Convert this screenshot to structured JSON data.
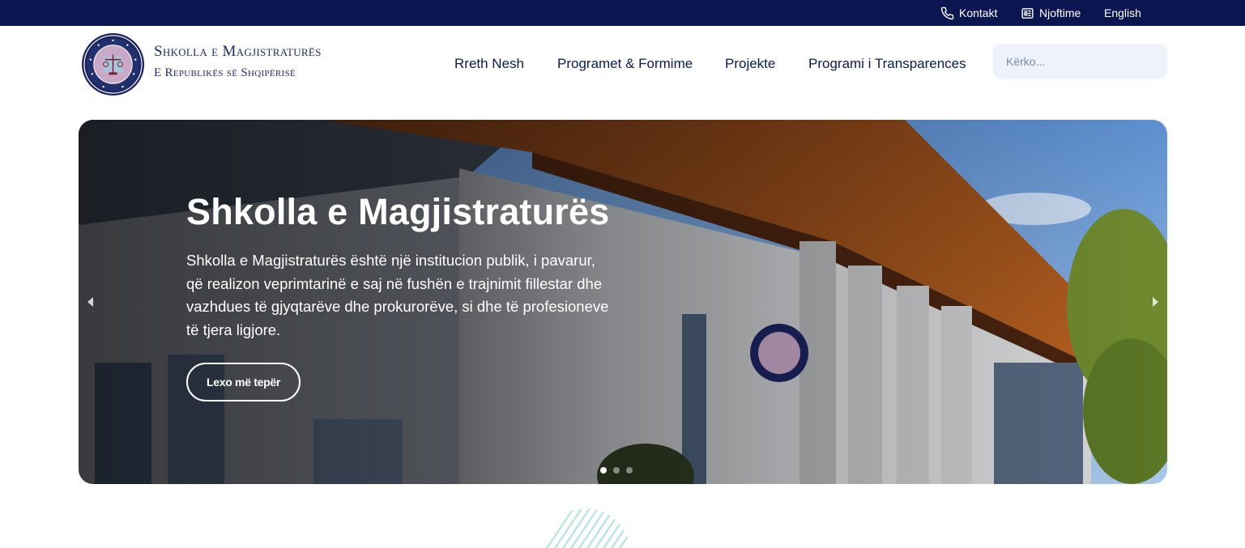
{
  "topbar": {
    "links": [
      {
        "label": "Kontakt",
        "icon": "phone-icon"
      },
      {
        "label": "Njoftime",
        "icon": "newspaper-icon"
      },
      {
        "label": "English"
      }
    ],
    "background": "#0b1650"
  },
  "header": {
    "brand_title": "Shkolla e Magjistraturës",
    "brand_subtitle": "E Republikës së Shqipërisë",
    "nav": [
      "Rreth Nesh",
      "Programet & Formime",
      "Projekte",
      "Programi i Transparences"
    ],
    "search_placeholder": "Kërko..."
  },
  "hero": {
    "title": "Shkolla e Magjistraturës",
    "text": "Shkolla e Magjistraturës është një institucion publik, i pavarur, që realizon veprimtarinë e saj në fushën e trajnimit fillestar dhe vazhdues të gjyqtarëve dhe prokurorëve, si dhe të profesioneve të tjera ligjore.",
    "button_label": "Lexo më tepër",
    "active_slide": 1
  },
  "colors": {
    "navy": "#0b1650",
    "text": "#0c1a4b",
    "search_bg": "#eef2fb",
    "deco": "#bfe5e0"
  }
}
